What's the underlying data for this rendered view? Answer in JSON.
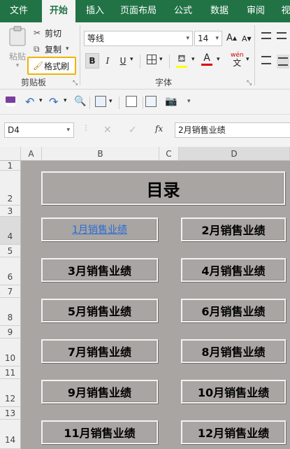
{
  "tabs": [
    "文件",
    "开始",
    "插入",
    "页面布局",
    "公式",
    "数据",
    "审阅",
    "视"
  ],
  "clipboard": {
    "paste": "粘贴",
    "cut": "剪切",
    "copy": "复制",
    "format_painter": "格式刷",
    "group": "剪贴板"
  },
  "font": {
    "name": "等线",
    "size": "14",
    "group": "字体",
    "bold": "B",
    "italic": "I",
    "underline": "U",
    "phonetic": "wén"
  },
  "formula_bar": {
    "name_box": "D4",
    "content": "2月销售业绩",
    "fx": "fx"
  },
  "columns": [
    "A",
    "B",
    "C",
    "D"
  ],
  "rows": [
    "1",
    "2",
    "3",
    "4",
    "5",
    "6",
    "7",
    "8",
    "9",
    "10",
    "11",
    "12",
    "13",
    "14"
  ],
  "sheet": {
    "title": "目录",
    "buttons": [
      "1月销售业绩",
      "2月销售业绩",
      "3月销售业绩",
      "4月销售业绩",
      "5月销售业绩",
      "6月销售业绩",
      "7月销售业绩",
      "8月销售业绩",
      "9月销售业绩",
      "10月销售业绩",
      "11月销售业绩",
      "12月销售业绩"
    ]
  },
  "colors": {
    "ribbon_green": "#217346",
    "sheet_bg": "#a8a5a2",
    "highlight": "#f0b400",
    "link": "#2b6cd4"
  }
}
